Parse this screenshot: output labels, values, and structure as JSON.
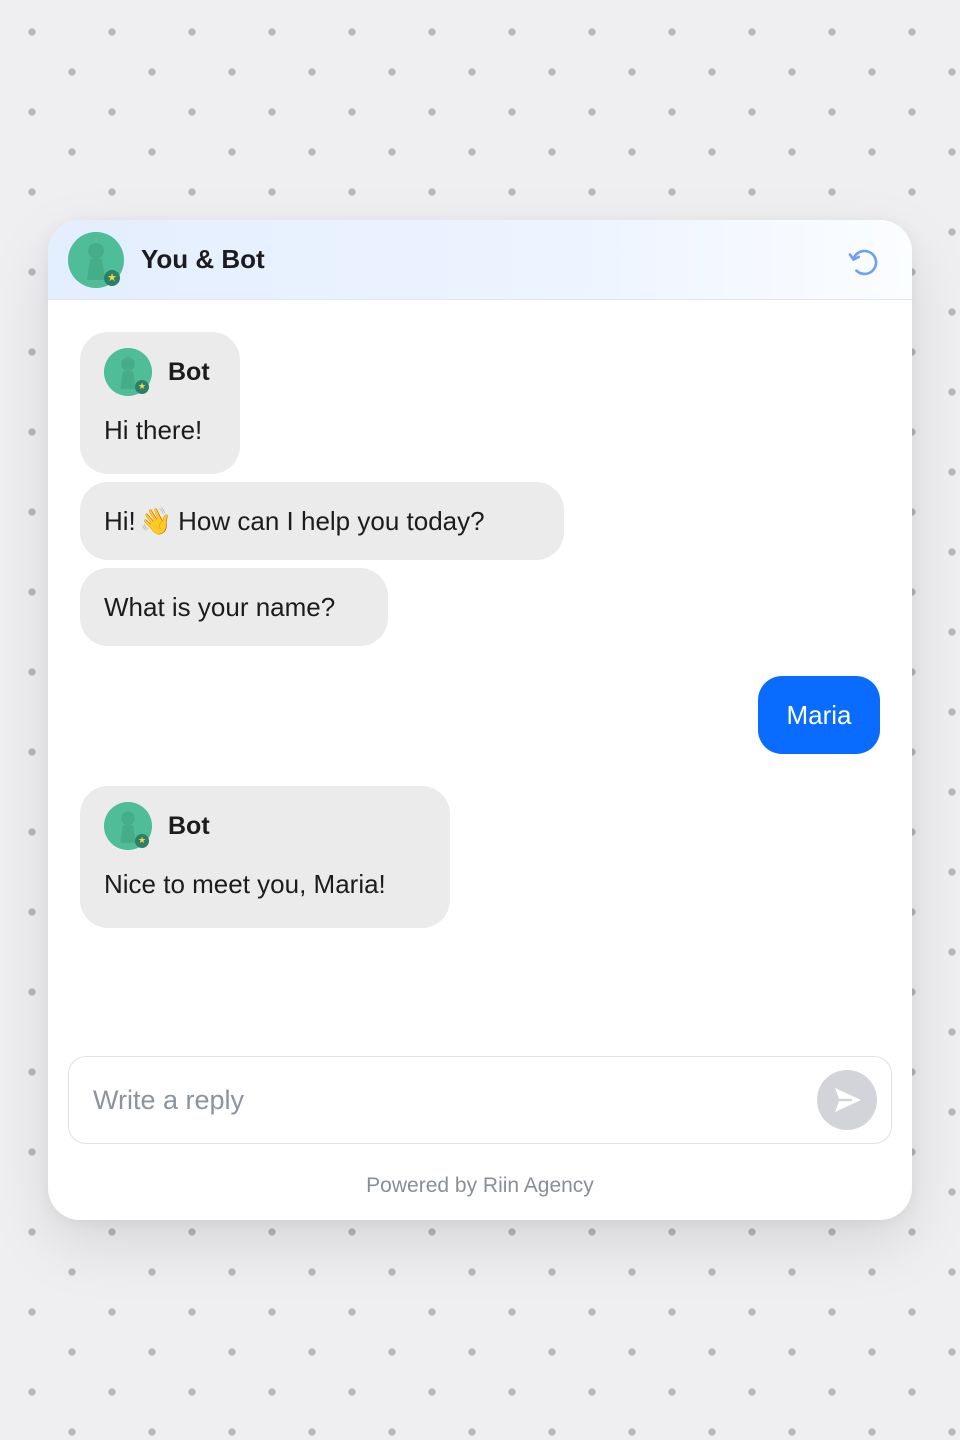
{
  "header": {
    "title": "You & Bot",
    "avatar_icon": "user-avatar-icon",
    "reset_icon": "reset-icon"
  },
  "messages": {
    "bot_sender_name": "Bot",
    "bot_greeting": "Hi there!",
    "bot_help_prefix": "Hi!",
    "bot_help_emoji": "👋",
    "bot_help_text": "How can I help you today?",
    "bot_question": "What is your name?",
    "user_reply": "Maria",
    "bot_reply_sender": "Bot",
    "bot_reply": "Nice to meet you, Maria!"
  },
  "composer": {
    "placeholder": "Write a reply",
    "value": "",
    "send_icon": "send-icon"
  },
  "footer": {
    "powered_by": "Powered by Riin Agency"
  },
  "colors": {
    "user_bubble": "#0a6cff",
    "bot_bubble": "#ebebeb",
    "avatar": "#4fbe98",
    "badge_star": "#f7d64a",
    "send_button": "#d2d4d9"
  }
}
